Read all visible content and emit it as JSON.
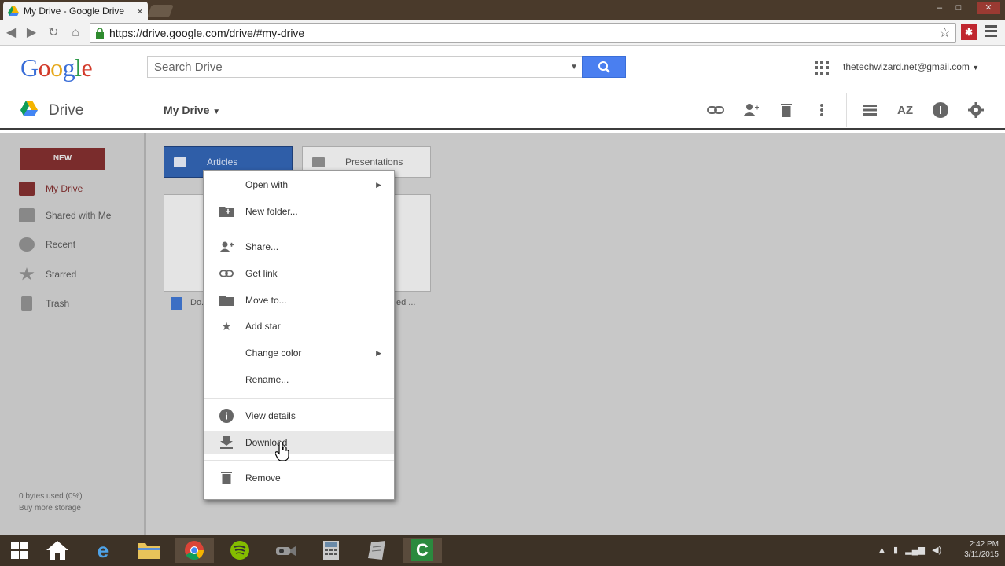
{
  "browser": {
    "tab_title": "My Drive - Google Drive",
    "tab_close": "×",
    "url": "https://drive.google.com/drive/#my-drive",
    "ext_label": "✱"
  },
  "header": {
    "logo": "Google",
    "search_placeholder": "Search Drive",
    "account": "thetechwizard.net@gmail.com"
  },
  "toolbar": {
    "drive_label": "Drive",
    "location": "My Drive",
    "icons": [
      "link-icon",
      "share-person-icon",
      "trash-icon",
      "more-vert-icon",
      "list-view-icon",
      "sort-az-icon",
      "info-icon",
      "settings-icon"
    ]
  },
  "sidebar": {
    "new_label": "NEW",
    "items": [
      {
        "label": "My Drive",
        "icon": "drive-icon",
        "active": true
      },
      {
        "label": "Shared with Me",
        "icon": "people-icon",
        "active": false
      },
      {
        "label": "Recent",
        "icon": "clock-icon",
        "active": false
      },
      {
        "label": "Starred",
        "icon": "star-icon",
        "active": false
      },
      {
        "label": "Trash",
        "icon": "trash-icon",
        "active": false
      }
    ],
    "storage_used": "0 bytes used (0%)",
    "buy_storage": "Buy more storage"
  },
  "folders": [
    {
      "name": "Articles",
      "selected": true
    },
    {
      "name": "Presentations",
      "selected": false
    }
  ],
  "file_fragments": {
    "left": "Do...",
    "right": "ed ..."
  },
  "context_menu": {
    "items": [
      {
        "label": "Open with",
        "icon": "",
        "submenu": true
      },
      {
        "label": "New folder...",
        "icon": "new-folder-icon",
        "submenu": false
      },
      {
        "label": "Share...",
        "icon": "share-person-icon",
        "submenu": false
      },
      {
        "label": "Get link",
        "icon": "link-icon",
        "submenu": false
      },
      {
        "label": "Move to...",
        "icon": "folder-icon",
        "submenu": false
      },
      {
        "label": "Add star",
        "icon": "star-icon",
        "submenu": false
      },
      {
        "label": "Change color",
        "icon": "",
        "submenu": true
      },
      {
        "label": "Rename...",
        "icon": "",
        "submenu": false
      },
      {
        "label": "View details",
        "icon": "info-icon",
        "submenu": false
      },
      {
        "label": "Download",
        "icon": "download-icon",
        "submenu": false,
        "hover": true
      },
      {
        "label": "Remove",
        "icon": "trash-icon",
        "submenu": false
      }
    ]
  },
  "taskbar": {
    "apps": [
      "windows-start-icon",
      "home-icon",
      "internet-explorer-icon",
      "file-explorer-icon",
      "chrome-icon",
      "spotify-icon",
      "camera-icon",
      "calculator-icon",
      "notepad-icon",
      "camtasia-icon"
    ],
    "time": "2:42 PM",
    "date": "3/11/2015"
  },
  "colors": {
    "accent_red": "#7a2c2c",
    "selected_blue": "#2f5ea8",
    "search_blue": "#4a7ff0"
  }
}
